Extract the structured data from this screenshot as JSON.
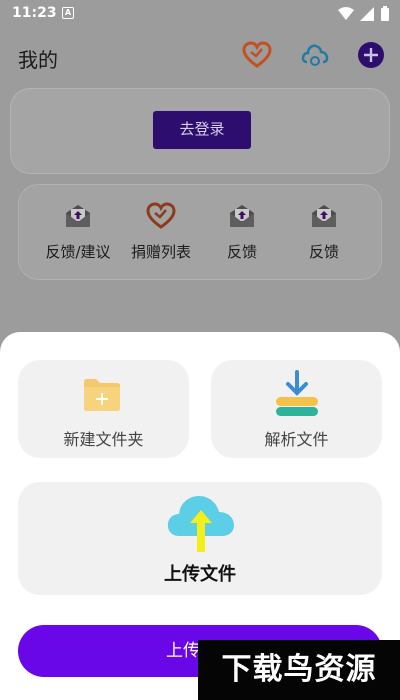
{
  "status_bar": {
    "time": "11:23",
    "notification_icon": "a-icon",
    "icons": [
      "wifi-icon",
      "signal-icon",
      "battery-icon"
    ]
  },
  "header": {
    "title": "我的",
    "icons": [
      "heart-icon",
      "cloud-sync-icon",
      "add-icon"
    ]
  },
  "login": {
    "button_label": "去登录"
  },
  "menu": {
    "items": [
      {
        "label": "反馈/建议",
        "icon": "mail-upload-icon"
      },
      {
        "label": "捐赠列表",
        "icon": "heart-icon"
      },
      {
        "label": "反馈",
        "icon": "mail-upload-icon"
      },
      {
        "label": "反馈",
        "icon": "mail-upload-icon"
      }
    ]
  },
  "sheet": {
    "new_folder_label": "新建文件夹",
    "parse_file_label": "解析文件",
    "upload_tile_label": "上传文件",
    "upload_button_label": "上传文件"
  },
  "watermark": {
    "text": "下载鸟资源"
  },
  "colors": {
    "accent": "#6a07e8",
    "login_button": "#2d0d6d",
    "heart": "#c4501f",
    "cloud": "#1f7aa6"
  }
}
